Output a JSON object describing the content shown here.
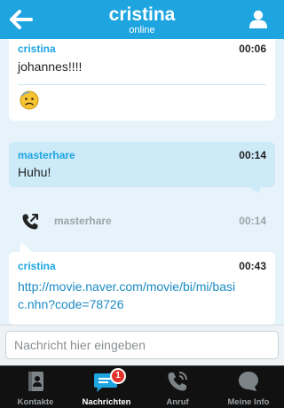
{
  "header": {
    "title": "cristina",
    "subtitle": "online",
    "back_icon": "arrow-left-icon",
    "profile_icon": "person-icon",
    "color": "#1ea5e0"
  },
  "messages": [
    {
      "sender": "cristina",
      "time": "00:06",
      "text": "johannes!!!!",
      "emoji": "worried-face-emoji"
    },
    {
      "sender": "masterhare",
      "time": "00:14",
      "text": "Huhu!"
    },
    {
      "call": true,
      "name": "masterhare",
      "time": "00:14",
      "icon": "outgoing-call-icon"
    },
    {
      "sender": "cristina",
      "time": "00:43",
      "text": "http://movie.naver.com/movie/bi/mi/basic.nhn?code=78726"
    }
  ],
  "composer": {
    "placeholder": "Nachricht hier eingeben"
  },
  "tabs": [
    {
      "label": "Kontakte",
      "icon": "contacts-book-icon"
    },
    {
      "label": "Nachrichten",
      "icon": "chat-bubble-icon",
      "badge": "1",
      "active": true
    },
    {
      "label": "Anruf",
      "icon": "phone-icon"
    },
    {
      "label": "Meine Info",
      "icon": "speech-bubble-icon"
    }
  ]
}
